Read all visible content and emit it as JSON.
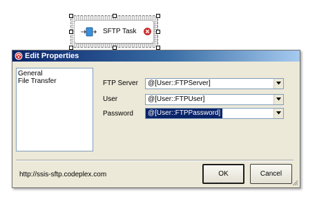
{
  "designer": {
    "task_label": "SFTP Task",
    "icons": {
      "task": "sftp-task-icon",
      "status": "error-icon"
    },
    "colors": {
      "error": "#e03030",
      "task_icon": "#3a8fd8"
    }
  },
  "dialog": {
    "title": "Edit Properties",
    "title_icon": "properties-icon",
    "nav_items": [
      "General",
      "File Transfer"
    ],
    "fields": {
      "ftp_server": {
        "label": "FTP Server",
        "value": "@[User::FTPServer]"
      },
      "user": {
        "label": "User",
        "value": "@[User::FTPUser]"
      },
      "password": {
        "label": "Password",
        "value": "@[User::FTPPassword]"
      }
    },
    "footer_link": "http://ssis-sftp.codeplex.com",
    "buttons": {
      "ok": "OK",
      "cancel": "Cancel"
    },
    "colors": {
      "titlebar": "#0a246a",
      "selection": "#0a246a",
      "face": "#ece9d8"
    }
  }
}
